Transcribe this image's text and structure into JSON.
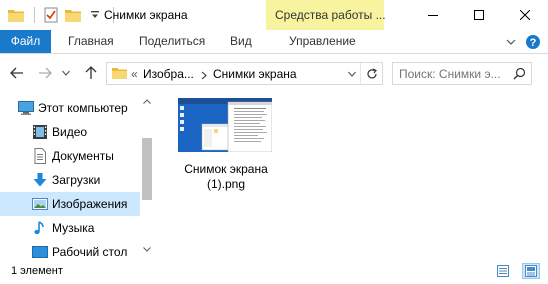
{
  "window": {
    "title": "Снимки экрана",
    "contextual_tab_group": "Средства работы ..."
  },
  "ribbon": {
    "tabs": [
      {
        "label": "Файл"
      },
      {
        "label": "Главная"
      },
      {
        "label": "Поделиться"
      },
      {
        "label": "Вид"
      },
      {
        "label": "Управление"
      }
    ]
  },
  "address_bar": {
    "overflow": "«",
    "path": [
      "Изобра...",
      "Снимки экрана"
    ]
  },
  "search": {
    "placeholder": "Поиск: Снимки э..."
  },
  "nav_pane": {
    "items": [
      {
        "label": "Этот компьютер",
        "icon": "computer-icon"
      },
      {
        "label": "Видео",
        "icon": "video-icon"
      },
      {
        "label": "Документы",
        "icon": "documents-icon"
      },
      {
        "label": "Загрузки",
        "icon": "downloads-icon"
      },
      {
        "label": "Изображения",
        "icon": "pictures-icon",
        "selected": true
      },
      {
        "label": "Музыка",
        "icon": "music-icon"
      },
      {
        "label": "Рабочий стол",
        "icon": "desktop-icon"
      }
    ]
  },
  "files": [
    {
      "name": "Снимок экрана (1).png",
      "line1": "Снимок экрана",
      "line2": "(1).png"
    }
  ],
  "status": {
    "item_count": "1 элемент"
  },
  "colors": {
    "file_tab": "#1979ca",
    "contextual_tab": "#f7f39e",
    "selection": "#cce8ff"
  }
}
